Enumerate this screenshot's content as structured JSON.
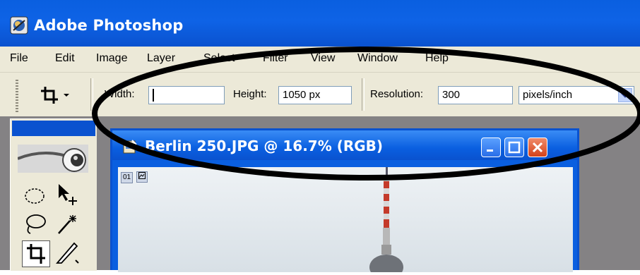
{
  "window": {
    "title": "Adobe Photoshop",
    "app_icon": "photoshop-icon"
  },
  "menu": {
    "items": [
      "File",
      "Edit",
      "Image",
      "Layer",
      "Select",
      "Filter",
      "View",
      "Window",
      "Help"
    ]
  },
  "options_bar": {
    "tool_icon": "crop-icon",
    "width_label": "Width:",
    "width_value": "",
    "height_label": "Height:",
    "height_value": "1050 px",
    "resolution_label": "Resolution:",
    "resolution_value": "300",
    "resolution_unit": "pixels/inch"
  },
  "document": {
    "title": "Berlin 250.JPG @ 16.7% (RGB)",
    "status_number": "01"
  },
  "colors": {
    "title_bar": "#0a5fe0",
    "chrome": "#ece9d8",
    "workspace": "#848284",
    "annotation": "#000000"
  }
}
